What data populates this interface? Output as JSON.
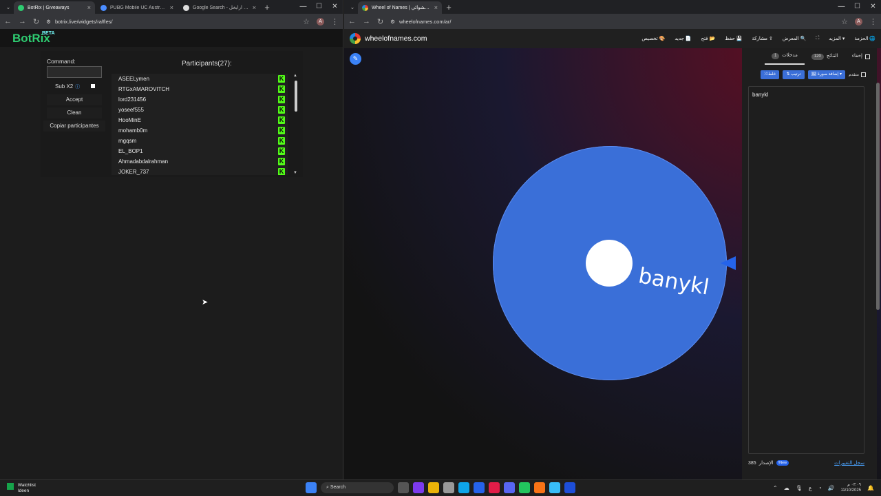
{
  "left_window": {
    "tabs": [
      {
        "label": "BotRix | Giveaways",
        "active": true
      },
      {
        "label": "PUBG Mobile UC Australia [10%",
        "active": false
      },
      {
        "label": "Google Search - خريطه ارابخل",
        "active": false
      }
    ],
    "url": "botrix.live/widgets/raffles/",
    "avatar_letter": "A",
    "app": {
      "logo": "BotRix",
      "beta": "BETA",
      "command_label": "Command:",
      "sub_label": "Sub X2",
      "accept": "Accept",
      "clean": "Clean",
      "copy": "Copiar participantes",
      "participants_title": "Participants(27):",
      "participants": [
        "ASEELymen",
        "RTGxAMAROVITCH",
        "lord231456",
        "yoseef555",
        "HooMinE",
        "mohamb0m",
        "mgqsm",
        "EL_BOP1",
        "Ahmadabdalrahman",
        "JOKER_737"
      ],
      "kick_badge": "K"
    }
  },
  "right_window": {
    "tabs": [
      {
        "label": "Wheel of Names | عجلة الأسماء العشوائي",
        "active": true
      }
    ],
    "url": "wheelofnames.com/ar/",
    "avatar_letter": "A",
    "site_name": "wheelofnames.com",
    "menu": [
      "الحزمة",
      "المزيد",
      "المعرض",
      "مشاركة",
      "حفظ",
      "فتح",
      "جديد",
      "تخصيص"
    ],
    "sidebar": {
      "hide": "إخفاء",
      "results_tab": "النتائج",
      "results_count": "120",
      "entries_tab": "مدخلات",
      "entries_count": "1",
      "advanced": "متقدم",
      "add_image": "إضافة صورة",
      "sort": "ترتيب",
      "shuffle": "خلط",
      "entries": [
        "banykl"
      ],
      "version_label": "الإصدار",
      "version": "385",
      "new_badge": "New!",
      "changelog": "سجل التغييرات"
    },
    "wheel_entry": "banykl",
    "wheel_color": "#3a6fd8"
  },
  "taskbar": {
    "watchlist": "Watchlist",
    "watchlist_sub": "Ideen",
    "search": "Search",
    "time": "٠٣:٠٩ م",
    "date": "11/10/2025"
  }
}
